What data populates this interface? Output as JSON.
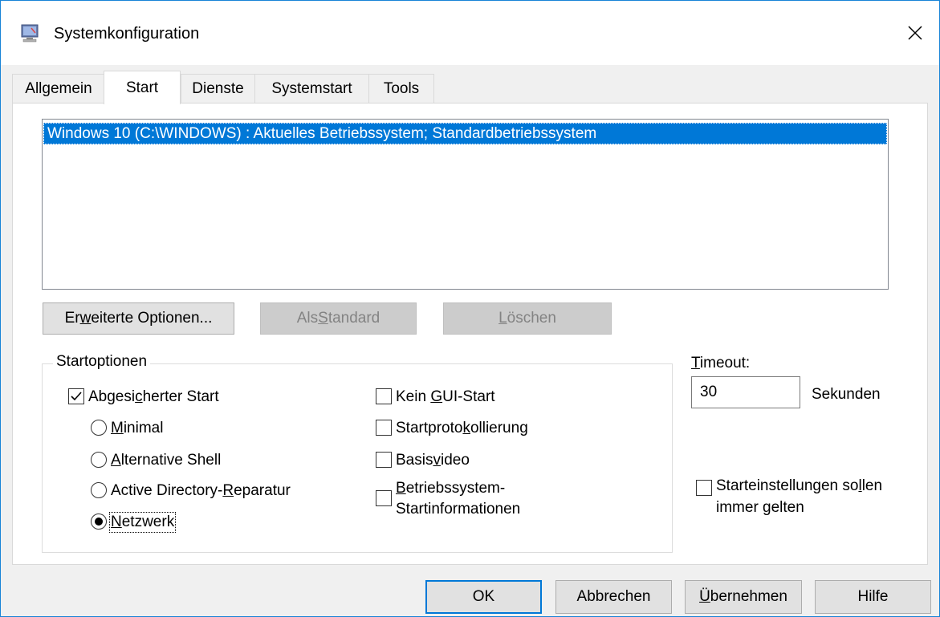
{
  "window": {
    "title": "Systemkonfiguration",
    "icon": "computer-icon",
    "close_glyph": "✕"
  },
  "tabs": [
    {
      "label": "Allgemein",
      "active": false
    },
    {
      "label": "Start",
      "active": true
    },
    {
      "label": "Dienste",
      "active": false
    },
    {
      "label": "Systemstart",
      "active": false
    },
    {
      "label": "Tools",
      "active": false
    }
  ],
  "os_list": {
    "items": [
      "Windows 10 (C:\\WINDOWS) : Aktuelles Betriebssystem; Standardbetriebssystem"
    ],
    "selected_index": 0
  },
  "list_buttons": {
    "advanced": {
      "pre": "Er",
      "key": "w",
      "post": "eiterte Optionen..."
    },
    "set_default": {
      "pre": "Als ",
      "key": "S",
      "post": "tandard"
    },
    "delete": {
      "pre": "",
      "key": "L",
      "post": "öschen"
    }
  },
  "boot_options": {
    "legend": "Startoptionen",
    "safe_boot": {
      "pre": "Abgesi",
      "key": "c",
      "post": "herter Start",
      "checked": true
    },
    "radios": [
      {
        "pre": "",
        "key": "M",
        "post": "inimal",
        "checked": false
      },
      {
        "pre": "",
        "key": "A",
        "post": "lternative Shell",
        "checked": false
      },
      {
        "pre": "Active Directory-",
        "key": "R",
        "post": "eparatur",
        "checked": false
      },
      {
        "pre": "",
        "key": "N",
        "post": "etzwerk",
        "checked": true
      }
    ],
    "no_gui": {
      "pre": "Kein ",
      "key": "G",
      "post": "UI-Start",
      "checked": false
    },
    "boot_log": {
      "pre": "Startproto",
      "key": "k",
      "post": "ollierung",
      "checked": false
    },
    "base_video": {
      "pre": "Basis",
      "key": "v",
      "post": "ideo",
      "checked": false
    },
    "os_boot_info": {
      "pre": "",
      "key": "B",
      "post": "etriebssystem-",
      "line2": "Startinformationen",
      "checked": false
    }
  },
  "timeout": {
    "pre": "",
    "key": "T",
    "post": "imeout:",
    "value": "30",
    "unit": "Sekunden"
  },
  "permanent": {
    "pre": "Starteinstellungen so",
    "key": "l",
    "post": "len",
    "line2": "immer gelten",
    "checked": false
  },
  "dialog_buttons": {
    "ok": "OK",
    "cancel": "Abbrechen",
    "apply": {
      "pre": "",
      "key": "Ü",
      "post": "bernehmen"
    },
    "help": "Hilfe"
  },
  "colors": {
    "accent": "#0078d7",
    "window_border": "#1883d7",
    "dialog_bg": "#f0f0f0"
  }
}
